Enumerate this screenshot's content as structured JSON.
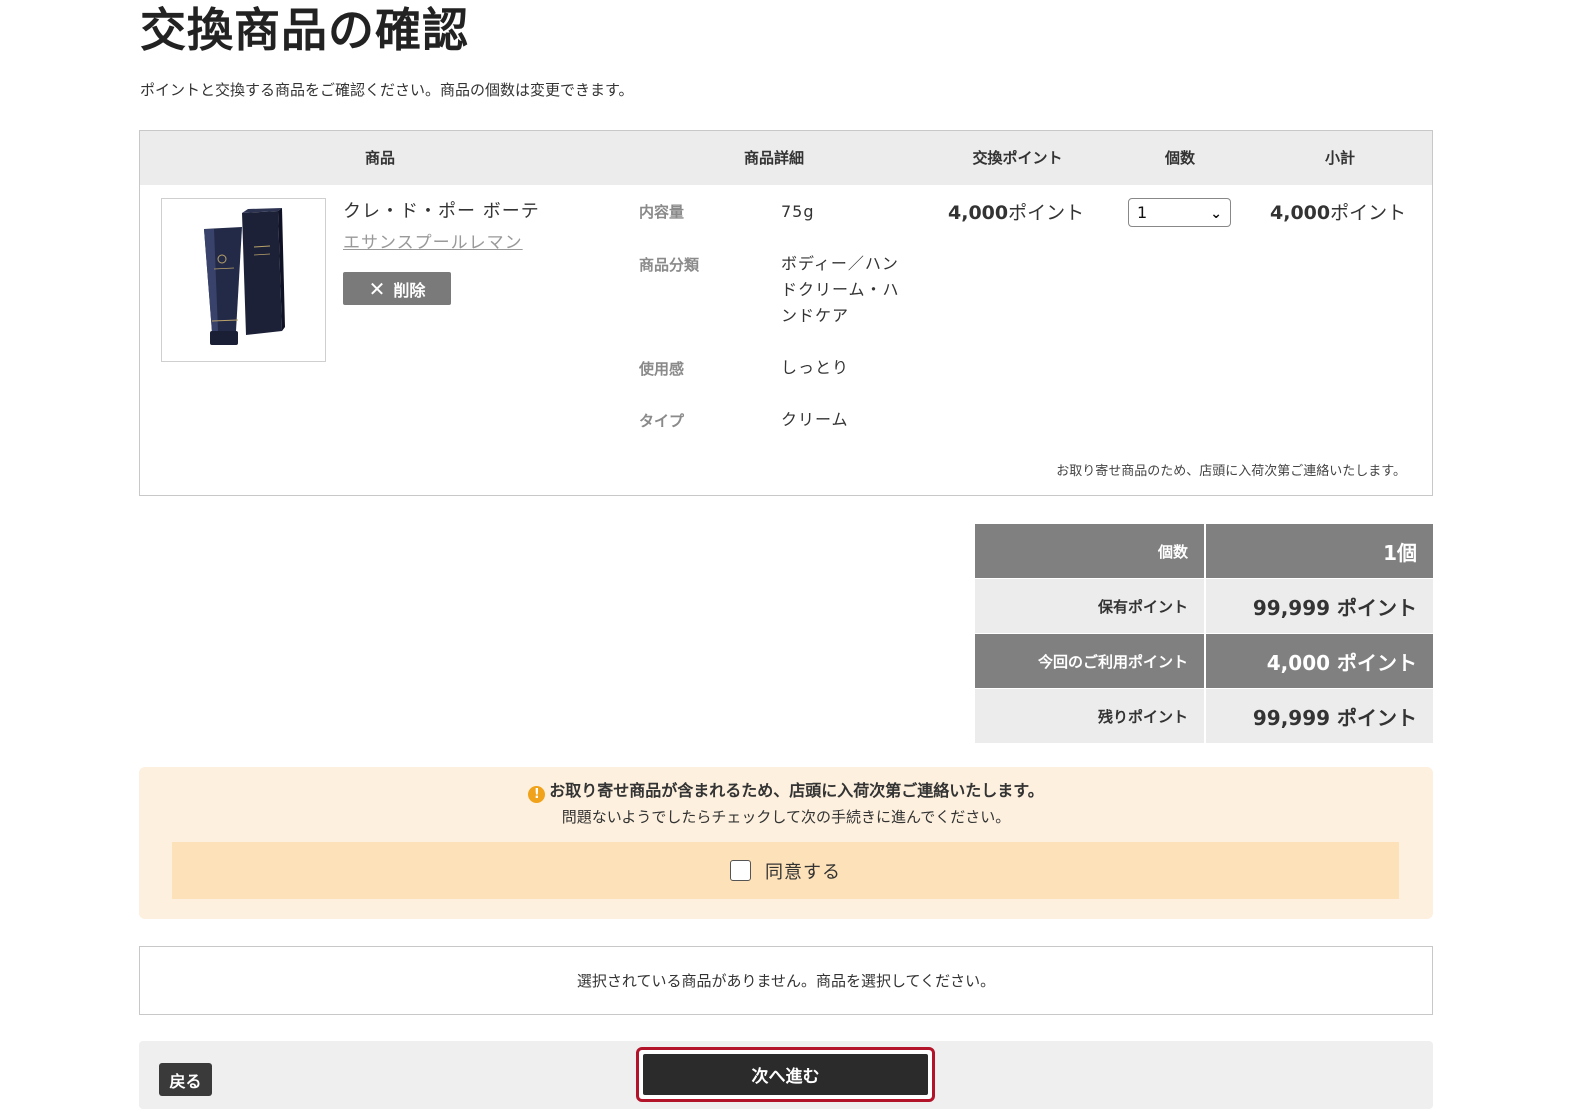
{
  "page": {
    "title": "交換商品の確認",
    "lead": "ポイントと交換する商品をご確認ください。商品の個数は変更できます。"
  },
  "cart": {
    "headers": {
      "product": "商品",
      "detail": "商品詳細",
      "points": "交換ポイント",
      "qty": "個数",
      "subtotal": "小計"
    },
    "item": {
      "brand": "クレ・ド・ポー ボーテ",
      "name": "エサンスプールレマン",
      "delete_label": "削除",
      "specs": [
        {
          "label": "内容量",
          "value": "75g"
        },
        {
          "label": "商品分類",
          "value": "ボディー／ハンドクリーム・ハンドケア"
        },
        {
          "label": "使用感",
          "value": "しっとり"
        },
        {
          "label": "タイプ",
          "value": "クリーム"
        }
      ],
      "points_number": "4,000",
      "points_unit": "ポイント",
      "qty_selected": "1",
      "subtotal_number": "4,000",
      "subtotal_unit": "ポイント"
    },
    "order_note": "お取り寄せ商品のため、店頭に入荷次第ご連絡いたします。"
  },
  "summary": {
    "rows": [
      {
        "label": "個数",
        "value": "1個"
      },
      {
        "label": "保有ポイント",
        "value": "99,999 ポイント"
      },
      {
        "label": "今回のご利用ポイント",
        "value": "4,000 ポイント"
      },
      {
        "label": "残りポイント",
        "value": "99,999 ポイント"
      }
    ]
  },
  "notice": {
    "icon": "!",
    "line1": "お取り寄せ商品が含まれるため、店頭に入荷次第ご連絡いたします。",
    "line2": "問題ないようでしたらチェックして次の手続きに進んでください。",
    "agree_label": "同意する",
    "agree_checked": false
  },
  "message": "選択されている商品がありません。商品を選択してください。",
  "footer": {
    "back_label": "戻る",
    "next_label": "次へ進む"
  },
  "colors": {
    "summary_dark": "#808080",
    "summary_light": "#ececec",
    "notice_bg": "#fdf0de",
    "agree_bg": "#fde1b8",
    "next_outline": "#b3142a",
    "warn_icon": "#f0a21a"
  }
}
